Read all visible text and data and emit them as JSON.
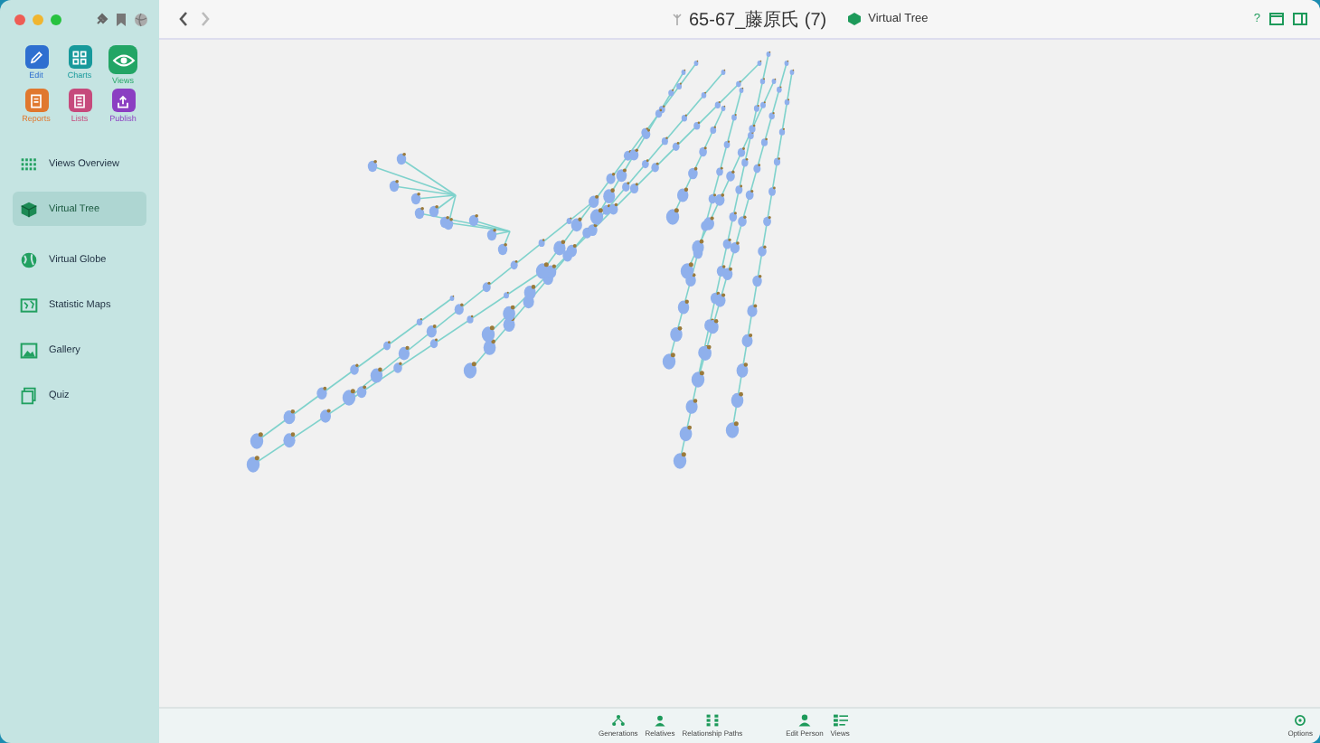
{
  "sidebar": {
    "tools": [
      {
        "label": "Edit",
        "kind": "edit",
        "color": "#2e6fd0",
        "selected": false
      },
      {
        "label": "Charts",
        "kind": "charts",
        "color": "#17999b",
        "selected": false
      },
      {
        "label": "Views",
        "kind": "views",
        "color": "#22a565",
        "selected": true
      },
      {
        "label": "Reports",
        "kind": "reports",
        "color": "#e0782e",
        "selected": false
      },
      {
        "label": "Lists",
        "kind": "lists",
        "color": "#c64a7c",
        "selected": false
      },
      {
        "label": "Publish",
        "kind": "publish",
        "color": "#8b3fc2",
        "selected": false
      }
    ],
    "nav": [
      {
        "label": "Views Overview",
        "kind": "overview",
        "selected": false
      },
      {
        "label": "Virtual Tree",
        "kind": "tree",
        "selected": true
      },
      {
        "label": "Virtual Globe",
        "kind": "globe",
        "selected": false
      },
      {
        "label": "Statistic Maps",
        "kind": "maps",
        "selected": false
      },
      {
        "label": "Gallery",
        "kind": "gallery",
        "selected": false
      },
      {
        "label": "Quiz",
        "kind": "quiz",
        "selected": false
      }
    ]
  },
  "toolbar": {
    "document": "65-67_藤原氏 (7)",
    "view": "Virtual Tree",
    "help": "?"
  },
  "bottom_bar": {
    "items": [
      {
        "label": "Generations",
        "kind": "generations"
      },
      {
        "label": "Relatives",
        "kind": "relatives"
      },
      {
        "label": "Relationship Paths",
        "kind": "paths"
      },
      {
        "label": "Edit Person",
        "kind": "person"
      },
      {
        "label": "Views",
        "kind": "views"
      }
    ],
    "options": "Options"
  }
}
